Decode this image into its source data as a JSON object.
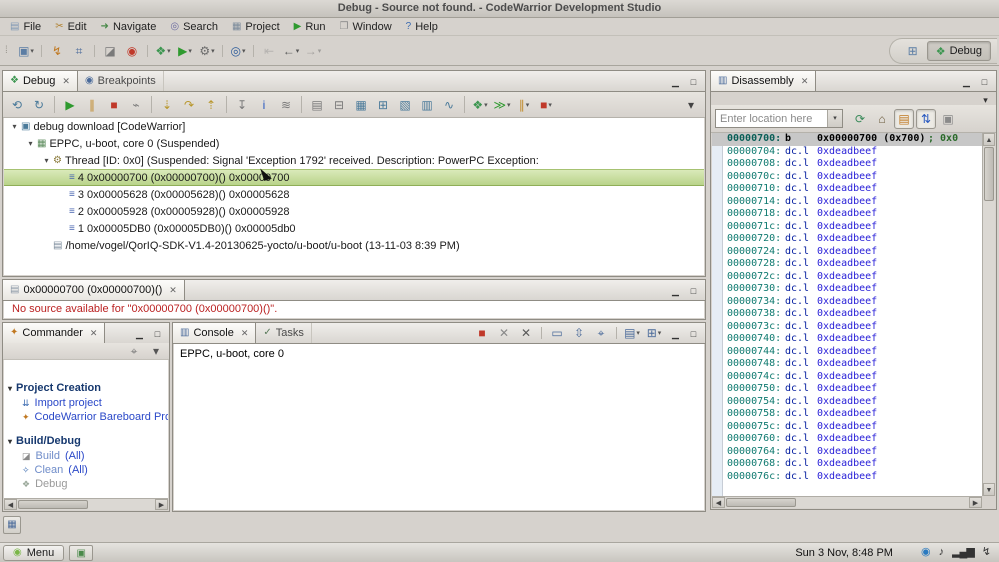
{
  "window": {
    "title": "Debug - Source not found. - CodeWarrior Development Studio"
  },
  "chrome": {
    "min_glyph": "▁",
    "max_glyph": "□",
    "close_glyph": "✕",
    "dropdown_glyph": "▾",
    "handle_glyph": "⁞"
  },
  "colors": {
    "selection_green": "#c6dd9c",
    "address_teal": "#0f7a70",
    "mnemonic_navy": "#001a9e",
    "operand_blue": "#2920d8",
    "error_red": "#bb2222",
    "link_blue": "#2a48c8"
  },
  "menu": {
    "items": [
      {
        "name": "menu-file",
        "label": "File",
        "glyph": "▤",
        "color": "#7d96b4"
      },
      {
        "name": "menu-edit",
        "label": "Edit",
        "glyph": "✂",
        "color": "#b08030"
      },
      {
        "name": "menu-navigate",
        "label": "Navigate",
        "glyph": "➜",
        "color": "#4a8a4a"
      },
      {
        "name": "menu-search",
        "label": "Search",
        "glyph": "◎",
        "color": "#6a6aa0"
      },
      {
        "name": "menu-project",
        "label": "Project",
        "glyph": "▦",
        "color": "#7a8a9a"
      },
      {
        "name": "menu-run",
        "label": "Run",
        "glyph": "▶",
        "color": "#2f9a2f"
      },
      {
        "name": "menu-window",
        "label": "Window",
        "glyph": "❐",
        "color": "#8a8a8a"
      },
      {
        "name": "menu-help",
        "label": "Help",
        "glyph": "?",
        "color": "#3a6ab0"
      }
    ]
  },
  "main_toolbar": {
    "icons": [
      {
        "name": "new-button",
        "glyph": "▣",
        "color": "#5b7da4",
        "dd": true
      },
      {
        "sep": true
      },
      {
        "name": "flash-programmer-button",
        "glyph": "↯",
        "color": "#c07820"
      },
      {
        "name": "target-connect-button",
        "glyph": "⌗",
        "color": "#4a6a9a"
      },
      {
        "sep": true
      },
      {
        "name": "build-button",
        "glyph": "◪",
        "color": "#7a7a7a"
      },
      {
        "name": "quick-access-button",
        "glyph": "◉",
        "color": "#c0392a"
      },
      {
        "sep": true
      },
      {
        "name": "debug-button",
        "glyph": "❖",
        "color": "#3c9650",
        "dd": true
      },
      {
        "name": "run-button",
        "glyph": "▶",
        "color": "#2f9a2f",
        "dd": true
      },
      {
        "name": "external-tools-button",
        "glyph": "⚙",
        "color": "#6a6a6a",
        "dd": true
      },
      {
        "sep": true
      },
      {
        "name": "search-button",
        "glyph": "◎",
        "color": "#2a5a9a",
        "dd": true
      },
      {
        "sep": true
      },
      {
        "name": "last-edit-button",
        "glyph": "⇤",
        "color": "#8a8a8a",
        "disabled": true
      },
      {
        "name": "back-button",
        "glyph": "←",
        "color": "#5a5a5a",
        "dd": true
      },
      {
        "name": "forward-button",
        "glyph": "→",
        "color": "#5a5a5a",
        "dd": true,
        "disabled": true
      }
    ]
  },
  "perspective": {
    "open_glyph": "⊞",
    "debug_glyph": "❖",
    "debug_label": "Debug"
  },
  "debug_view": {
    "tabs": [
      "Debug",
      "Breakpoints"
    ],
    "toolbar": [
      {
        "name": "reset-target-button",
        "glyph": "⟲",
        "color": "#4a7a9a"
      },
      {
        "name": "restart-button",
        "glyph": "↻",
        "color": "#4a7a9a"
      },
      {
        "sep": true
      },
      {
        "name": "resume-button",
        "glyph": "▶",
        "color": "#2f9a2f"
      },
      {
        "name": "suspend-button",
        "glyph": "∥",
        "color": "#c08a2a"
      },
      {
        "name": "terminate-button",
        "glyph": "■",
        "color": "#c0392a"
      },
      {
        "name": "disconnect-button",
        "glyph": "⌁",
        "color": "#7a7a7a"
      },
      {
        "sep": true
      },
      {
        "name": "step-into-button",
        "glyph": "⇣",
        "color": "#b8962a"
      },
      {
        "name": "step-over-button",
        "glyph": "↷",
        "color": "#b8962a"
      },
      {
        "name": "step-return-button",
        "glyph": "⇡",
        "color": "#b8962a"
      },
      {
        "sep": true
      },
      {
        "name": "drop-to-frame-button",
        "glyph": "↧",
        "color": "#7a7a7a"
      },
      {
        "name": "instruction-stepping-button",
        "glyph": "i",
        "color": "#2a5ac0"
      },
      {
        "name": "step-filters-button",
        "glyph": "≋",
        "color": "#7a7a7a"
      },
      {
        "sep": true
      },
      {
        "name": "show-full-paths-button",
        "glyph": "▤",
        "color": "#7a7a7a"
      },
      {
        "name": "collapse-all-button",
        "glyph": "⊟",
        "color": "#7a7a7a"
      },
      {
        "name": "view-memory-button",
        "glyph": "▦",
        "color": "#4a7a9a"
      },
      {
        "name": "view-registers-button",
        "glyph": "⊞",
        "color": "#4a7a9a"
      },
      {
        "name": "view-variables-button",
        "glyph": "▧",
        "color": "#4a7a9a"
      },
      {
        "name": "view-modules-button",
        "glyph": "▥",
        "color": "#4a7a9a"
      },
      {
        "name": "trace-button",
        "glyph": "∿",
        "color": "#4a7a9a"
      },
      {
        "sep": true
      },
      {
        "name": "debug-menu-button",
        "glyph": "❖",
        "color": "#3c9650",
        "dd": true
      },
      {
        "name": "multicore-resume-button",
        "glyph": "≫",
        "color": "#2f9a2f",
        "dd": true
      },
      {
        "name": "multicore-suspend-button",
        "glyph": "∥",
        "color": "#c08a2a",
        "dd": true
      },
      {
        "name": "multicore-terminate-button",
        "glyph": "■",
        "color": "#c0392a",
        "dd": true
      },
      {
        "name": "view-menu-button",
        "glyph": "▾",
        "color": "#444",
        "right": true
      }
    ],
    "tree": [
      {
        "indent": 0,
        "exp": "▾",
        "icon": {
          "name": "debug-target-icon",
          "glyph": "▣",
          "color": "#4a7a9a"
        },
        "label": "debug download [CodeWarrior]"
      },
      {
        "indent": 1,
        "exp": "▾",
        "icon": {
          "name": "core-icon",
          "glyph": "▦",
          "color": "#5a8a5a"
        },
        "label": "EPPC, u-boot, core 0 (Suspended)"
      },
      {
        "indent": 2,
        "exp": "▾",
        "icon": {
          "name": "thread-icon",
          "glyph": "⚙",
          "color": "#8a7a3a"
        },
        "label": "Thread [ID: 0x0] (Suspended: Signal 'Exception 1792' received. Description: PowerPC Exception:"
      },
      {
        "indent": 3,
        "icon": {
          "name": "stack-frame-icon",
          "glyph": "≡",
          "color": "#4a66b0"
        },
        "label": "4 0x00000700 (0x00000700)()  0x00000700",
        "selected": true
      },
      {
        "indent": 3,
        "icon": {
          "name": "stack-frame-icon",
          "glyph": "≡",
          "color": "#4a66b0"
        },
        "label": "3 0x00005628 (0x00005628)()  0x00005628"
      },
      {
        "indent": 3,
        "icon": {
          "name": "stack-frame-icon",
          "glyph": "≡",
          "color": "#4a66b0"
        },
        "label": "2 0x00005928 (0x00005928)()  0x00005928"
      },
      {
        "indent": 3,
        "icon": {
          "name": "stack-frame-icon",
          "glyph": "≡",
          "color": "#4a66b0"
        },
        "label": "1 0x00005DB0 (0x00005DB0)()  0x00005db0"
      },
      {
        "indent": 2,
        "icon": {
          "name": "binary-file-icon",
          "glyph": "▤",
          "color": "#7a8a9a"
        },
        "label": "/home/vogel/QorIQ-SDK-V1.4-20130625-yocto/u-boot/u-boot (13-11-03 8:39 PM)"
      }
    ]
  },
  "editor": {
    "tab": "0x00000700 (0x00000700)()",
    "message": "No source available for \"0x00000700 (0x00000700)()\"."
  },
  "commander": {
    "tab": "Commander",
    "toolbar": [
      {
        "name": "link-with-editor-button",
        "glyph": "⌖",
        "color": "#7a7a7a"
      },
      {
        "name": "view-menu-button",
        "glyph": "▾",
        "color": "#555"
      }
    ],
    "sections": [
      {
        "title": "Project Creation",
        "items": [
          {
            "name": "import-project-link",
            "label": "Import project",
            "glyph": "⇊",
            "color": "#3a6ab0",
            "style": "link"
          },
          {
            "name": "bareboard-project-link",
            "label": "CodeWarrior Bareboard Project",
            "glyph": "✦",
            "color": "#c07820",
            "style": "link"
          }
        ]
      },
      {
        "title": "Build/Debug",
        "items": [
          {
            "name": "build-all-link",
            "label": "Build",
            "suffix": " (All)",
            "glyph": "◪",
            "color": "#8a8a8a",
            "style": "half"
          },
          {
            "name": "clean-all-link",
            "label": "Clean",
            "suffix": " (All)",
            "glyph": "✧",
            "color": "#3a6ab0",
            "style": "half"
          },
          {
            "name": "debug-link",
            "label": "Debug",
            "glyph": "❖",
            "color": "#9aa89a",
            "style": "dim"
          }
        ]
      }
    ]
  },
  "console": {
    "tabs": [
      "Console",
      "Tasks"
    ],
    "toolbar": [
      {
        "name": "terminate-button",
        "glyph": "■",
        "color": "#c0392a"
      },
      {
        "name": "remove-launch-button",
        "glyph": "✕",
        "color": "#8a8a8a"
      },
      {
        "name": "remove-all-launches-button",
        "glyph": "✕",
        "color": "#5a5a5a"
      },
      {
        "sep": true
      },
      {
        "name": "clear-console-button",
        "glyph": "▭",
        "color": "#4a6a9a"
      },
      {
        "name": "scroll-lock-button",
        "glyph": "⇳",
        "color": "#4a6a9a"
      },
      {
        "name": "pin-console-button",
        "glyph": "⌖",
        "color": "#4a6a9a"
      },
      {
        "sep": true
      },
      {
        "name": "display-console-button",
        "glyph": "▤",
        "color": "#4a6a9a",
        "dd": true
      },
      {
        "name": "open-console-button",
        "glyph": "⊞",
        "color": "#4a6a9a",
        "dd": true
      }
    ],
    "text": "EPPC, u-boot, core 0"
  },
  "disassembly": {
    "tab": "Disassembly",
    "location_placeholder": "Enter location here",
    "toolbar": [
      {
        "name": "refresh-button",
        "glyph": "⟳",
        "color": "#3a8a5a"
      },
      {
        "name": "home-button",
        "glyph": "⌂",
        "color": "#6a5a3a"
      },
      {
        "name": "show-source-toggle",
        "glyph": "▤",
        "color": "#c07820",
        "active": true
      },
      {
        "name": "sync-selection-toggle",
        "glyph": "⇅",
        "color": "#2a5ac0",
        "active": true
      },
      {
        "name": "disassembly-settings-button",
        "glyph": "▣",
        "color": "#8a8a8a"
      }
    ],
    "rows": [
      {
        "a": "00000700:",
        "m": "b",
        "o": "0x00000700 (0x700)",
        "c": "; 0x0",
        "cur": true
      },
      {
        "a": "00000704:",
        "m": "dc.l",
        "o": "0xdeadbeef"
      },
      {
        "a": "00000708:",
        "m": "dc.l",
        "o": "0xdeadbeef"
      },
      {
        "a": "0000070c:",
        "m": "dc.l",
        "o": "0xdeadbeef"
      },
      {
        "a": "00000710:",
        "m": "dc.l",
        "o": "0xdeadbeef"
      },
      {
        "a": "00000714:",
        "m": "dc.l",
        "o": "0xdeadbeef"
      },
      {
        "a": "00000718:",
        "m": "dc.l",
        "o": "0xdeadbeef"
      },
      {
        "a": "0000071c:",
        "m": "dc.l",
        "o": "0xdeadbeef"
      },
      {
        "a": "00000720:",
        "m": "dc.l",
        "o": "0xdeadbeef"
      },
      {
        "a": "00000724:",
        "m": "dc.l",
        "o": "0xdeadbeef"
      },
      {
        "a": "00000728:",
        "m": "dc.l",
        "o": "0xdeadbeef"
      },
      {
        "a": "0000072c:",
        "m": "dc.l",
        "o": "0xdeadbeef"
      },
      {
        "a": "00000730:",
        "m": "dc.l",
        "o": "0xdeadbeef"
      },
      {
        "a": "00000734:",
        "m": "dc.l",
        "o": "0xdeadbeef"
      },
      {
        "a": "00000738:",
        "m": "dc.l",
        "o": "0xdeadbeef"
      },
      {
        "a": "0000073c:",
        "m": "dc.l",
        "o": "0xdeadbeef"
      },
      {
        "a": "00000740:",
        "m": "dc.l",
        "o": "0xdeadbeef"
      },
      {
        "a": "00000744:",
        "m": "dc.l",
        "o": "0xdeadbeef"
      },
      {
        "a": "00000748:",
        "m": "dc.l",
        "o": "0xdeadbeef"
      },
      {
        "a": "0000074c:",
        "m": "dc.l",
        "o": "0xdeadbeef"
      },
      {
        "a": "00000750:",
        "m": "dc.l",
        "o": "0xdeadbeef"
      },
      {
        "a": "00000754:",
        "m": "dc.l",
        "o": "0xdeadbeef"
      },
      {
        "a": "00000758:",
        "m": "dc.l",
        "o": "0xdeadbeef"
      },
      {
        "a": "0000075c:",
        "m": "dc.l",
        "o": "0xdeadbeef"
      },
      {
        "a": "00000760:",
        "m": "dc.l",
        "o": "0xdeadbeef"
      },
      {
        "a": "00000764:",
        "m": "dc.l",
        "o": "0xdeadbeef"
      },
      {
        "a": "00000768:",
        "m": "dc.l",
        "o": "0xdeadbeef"
      },
      {
        "a": "0000076c:",
        "m": "dc.l",
        "o": "0xdeadbeef"
      }
    ]
  },
  "taskbar": {
    "menu_label": "Menu",
    "clock": "Sun 3 Nov, 8:48 PM"
  }
}
